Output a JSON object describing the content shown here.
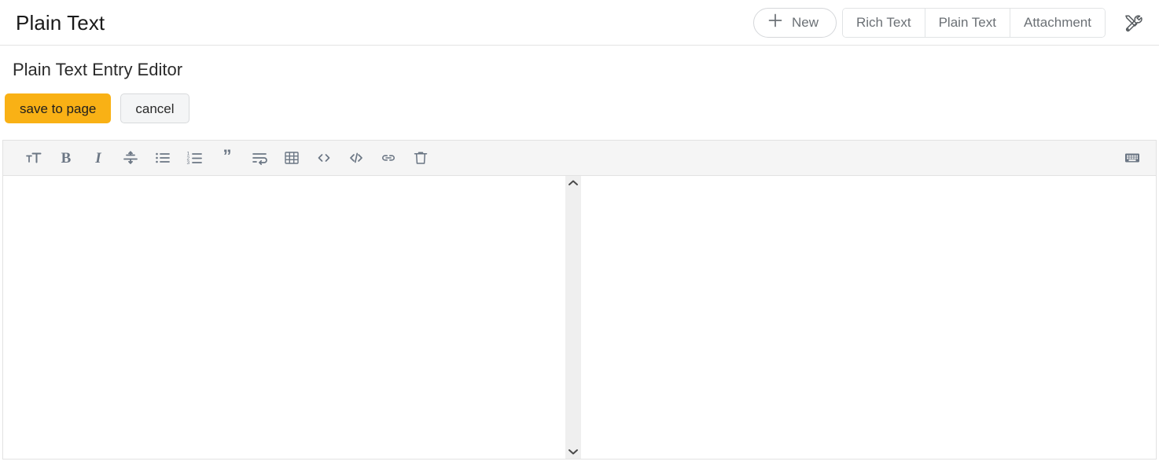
{
  "header": {
    "title": "Plain Text",
    "new_button": {
      "label": "New",
      "icon": "plus-icon"
    },
    "segments": [
      {
        "label": "Rich Text",
        "name": "rich-text"
      },
      {
        "label": "Plain Text",
        "name": "plain-text"
      },
      {
        "label": "Attachment",
        "name": "attachment"
      }
    ],
    "tools_icon": "tools-icon"
  },
  "editor": {
    "page_title": "Plain Text Entry Editor",
    "save_label": "save to page",
    "cancel_label": "cancel",
    "textarea_value": "",
    "textarea_placeholder": "",
    "toolbar": [
      {
        "name": "font-size-icon",
        "title": "Font Size"
      },
      {
        "name": "bold-icon",
        "title": "Bold"
      },
      {
        "name": "italic-icon",
        "title": "Italic"
      },
      {
        "name": "vertical-align-icon",
        "title": "Align"
      },
      {
        "name": "bulleted-list-icon",
        "title": "Bulleted List"
      },
      {
        "name": "numbered-list-icon",
        "title": "Numbered List"
      },
      {
        "name": "quote-icon",
        "title": "Quote"
      },
      {
        "name": "indent-icon",
        "title": "Indent"
      },
      {
        "name": "table-icon",
        "title": "Table"
      },
      {
        "name": "code-block-icon",
        "title": "Code Block"
      },
      {
        "name": "inline-code-icon",
        "title": "Inline Code"
      },
      {
        "name": "link-icon",
        "title": "Link"
      },
      {
        "name": "trash-icon",
        "title": "Delete"
      }
    ],
    "keyboard_icon": "keyboard-icon",
    "scrollbar": {
      "up": "chevron-up-icon",
      "down": "chevron-down-icon"
    }
  },
  "colors": {
    "accent": "#f9b115",
    "toolbar_bg": "#f5f5f5",
    "border": "#e2e2e2",
    "icon": "#6b7684",
    "muted_text": "#6b7075"
  }
}
